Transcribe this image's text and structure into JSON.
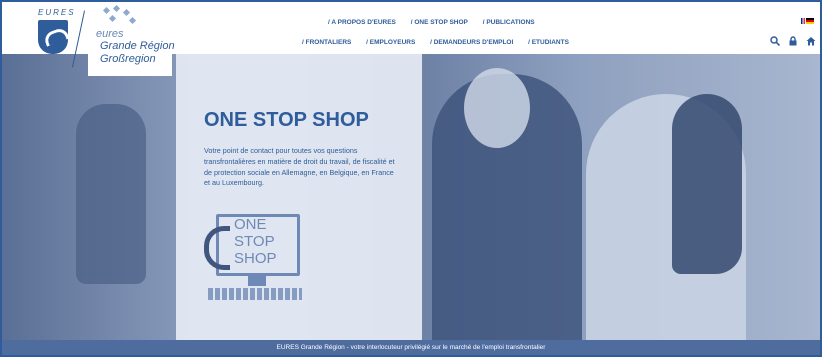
{
  "logo": {
    "top_text": "EURES",
    "eures_text": "eures",
    "line1": "Grande Région",
    "line2": "Großregion"
  },
  "nav": {
    "row1": [
      "/ A PROPOS D'EURES",
      "/ ONE STOP SHOP",
      "/ PUBLICATIONS"
    ],
    "row2": [
      "/ FRONTALIERS",
      "/ EMPLOYEURS",
      "/ DEMANDEURS D'EMPLOI",
      "/ ETUDIANTS"
    ]
  },
  "tools": {
    "search_icon": "search-icon",
    "lock_icon": "lock-icon",
    "home_icon": "home-icon"
  },
  "hero": {
    "title": "ONE STOP SHOP",
    "text": "Votre point de contact pour toutes vos questions transfrontalières en matière de droit du travail, de fiscalité et de protection sociale en Allemagne, en Belgique, en France et au Luxembourg.",
    "icon_text": [
      "ONE",
      "STOP",
      "SHOP"
    ]
  },
  "footer": {
    "tagline": "EURES Grande Région - votre interlocuteur privilégié sur le marché de l'emploi transfrontalier"
  },
  "colors": {
    "brand": "#2f5c9a",
    "footer_bg": "#4f6c9f",
    "panel_bg": "#e6ecf5"
  }
}
